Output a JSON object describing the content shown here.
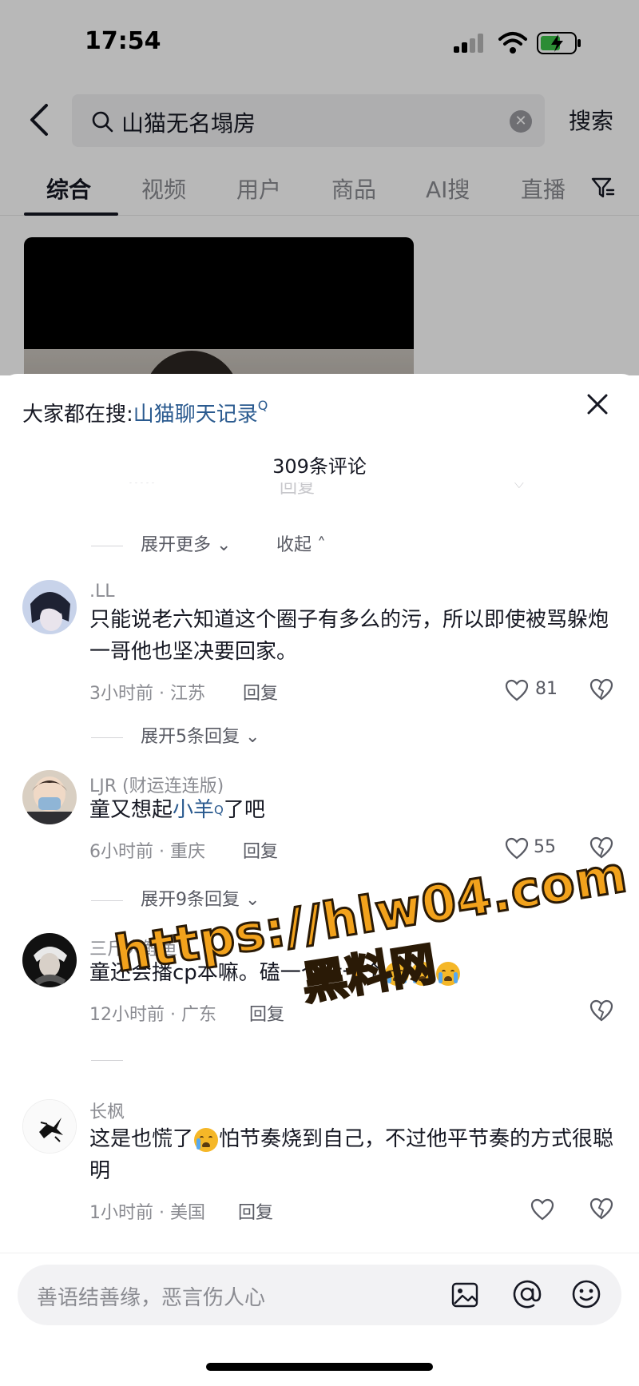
{
  "status_bar": {
    "time": "17:54"
  },
  "search": {
    "query": "山猫无名塌房",
    "button": "搜索"
  },
  "tabs": [
    "综合",
    "视频",
    "用户",
    "商品",
    "AI搜",
    "直播"
  ],
  "sheet": {
    "hot_search_label": "大家都在搜:",
    "hot_search_term": "山猫聊天记录",
    "comment_count": "309条评论",
    "expand_more": "展开更多",
    "collapse": "收起",
    "reply_label": "回复"
  },
  "comments": [
    {
      "nick": ".LL",
      "text": "只能说老六知道这个圈子有多么的污，所以即使被骂躲炮一哥他也坚决要回家。",
      "meta": "3小时前 · 江苏",
      "likes": "81",
      "expand": "展开5条回复"
    },
    {
      "nick": "LJR (财运连连版)",
      "text_before": "童又想起",
      "text_link": "小羊",
      "text_after": "了吧",
      "meta": "6小时前 · 重庆",
      "likes": "55",
      "expand": "展开9条回复"
    },
    {
      "nick": "三斤大鲤鱼",
      "text": "童还会播cp本嘛。磕一个没一个",
      "meta": "12小时前 · 广东",
      "likes": ""
    },
    {
      "nick": "长枫",
      "text_before": "这是也慌了",
      "text_after": "怕节奏烧到自己，不过他平节奏的方式很聪明",
      "meta": "1小时前 · 美国",
      "likes": ""
    }
  ],
  "watermark": {
    "url": "https://hlw04.com",
    "name": "黑料网"
  },
  "input": {
    "placeholder": "善语结善缘，恶言伤人心"
  },
  "icons": [
    "back-icon",
    "search-icon",
    "clear-icon",
    "filter-icon",
    "close-icon",
    "heart-icon",
    "dislike-icon",
    "image-icon",
    "at-icon",
    "emoji-icon"
  ],
  "colors": {
    "link": "#2a5a8f",
    "watermark": "#f2a21c"
  }
}
